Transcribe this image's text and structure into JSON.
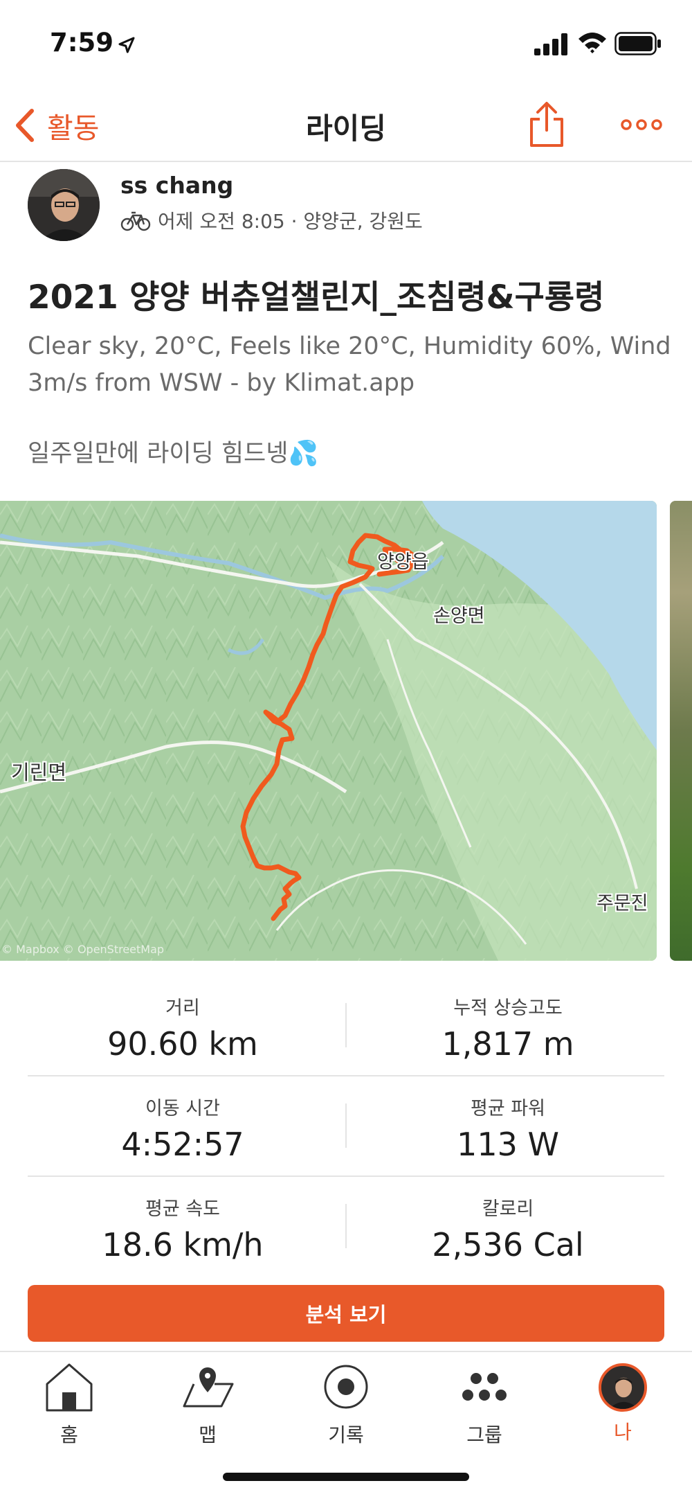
{
  "status_bar": {
    "time": "7:59"
  },
  "header": {
    "back_label": "활동",
    "title": "라이딩"
  },
  "athlete": {
    "name": "ss chang",
    "meta": "어제 오전 8:05 · 양양군, 강원도"
  },
  "activity": {
    "title": "2021 양양 버츄얼챌린지_조침령&구룡령",
    "description": "Clear sky, 20°C, Feels like 20°C, Humidity 60%, Wind 3m/s from WSW - by Klimat.app",
    "note": "일주일만에 라이딩 힘드넹💦"
  },
  "map": {
    "labels": {
      "town_yangyang": "양양읍",
      "son_yang": "손양면",
      "girin": "기린면",
      "jumun": "주문진"
    },
    "attribution": "© Mapbox © OpenStreetMap",
    "colors": {
      "route": "#f05a1e",
      "land": "#a9cfa3",
      "sea": "#b5d8ea"
    }
  },
  "stats": [
    {
      "label": "거리",
      "value": "90.60 km"
    },
    {
      "label": "누적 상승고도",
      "value": "1,817 m"
    },
    {
      "label": "이동 시간",
      "value": "4:52:57"
    },
    {
      "label": "평균 파워",
      "value": "113 W"
    },
    {
      "label": "평균 속도",
      "value": "18.6 km/h"
    },
    {
      "label": "칼로리",
      "value": "2,536 Cal"
    }
  ],
  "analysis_button": "분석 보기",
  "tabs": [
    {
      "label": "홈",
      "icon": "home-icon"
    },
    {
      "label": "맵",
      "icon": "map-icon"
    },
    {
      "label": "기록",
      "icon": "record-icon"
    },
    {
      "label": "그룹",
      "icon": "groups-icon"
    },
    {
      "label": "나",
      "icon": "profile-avatar",
      "active": true
    }
  ],
  "accent_color": "#e8582a"
}
